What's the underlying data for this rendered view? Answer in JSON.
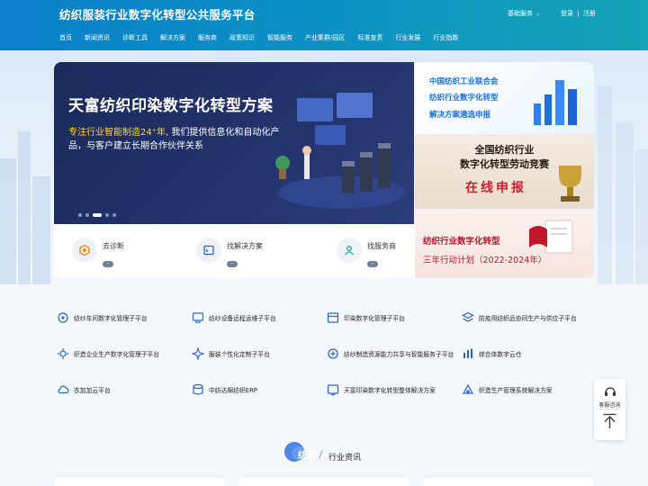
{
  "header": {
    "site_title": "纺织服装行业数字化转型公共服务平台",
    "basic_services": "基础服务",
    "login": "登录",
    "separator": "|",
    "register": "注册"
  },
  "nav": [
    "首页",
    "新闻资讯",
    "诊断工具",
    "解决方案",
    "服务商",
    "政策知识",
    "智能服务",
    "产业集群/园区",
    "标准宣贯",
    "行业发展",
    "行业指数"
  ],
  "banner": {
    "title": "天富纺织印染数字化转型方案",
    "subtitle_highlight": "专注行业智能制造24⁺年,",
    "subtitle_rest": " 我们提供信息化和自动化产品，与客户建立长期合作伙伴关系",
    "slide_count": 5,
    "active_slide": 3
  },
  "promos": {
    "p1": [
      "中国纺织工业联合会",
      "纺织行业数字化转型",
      "解决方案遴选申报"
    ],
    "p2": [
      "全国纺织行业",
      "数字化转型劳动竞赛",
      "在线申报"
    ],
    "p3": [
      "纺织行业数字化转型",
      "三年行动计划（2022-2024年）"
    ]
  },
  "quick_links": [
    {
      "label": "去诊断",
      "icon": "diagnose-icon"
    },
    {
      "label": "找解决方案",
      "icon": "solution-icon"
    },
    {
      "label": "找服务商",
      "icon": "provider-icon"
    }
  ],
  "platforms": [
    {
      "label": "纺纱车间数字化管理子平台",
      "icon": "workshop-icon"
    },
    {
      "label": "纺纱设备远程运维子平台",
      "icon": "remote-ops-icon"
    },
    {
      "label": "印染数字化管理子平台",
      "icon": "dyeing-icon"
    },
    {
      "label": "防疫用纺织品协同生产与供应子平台",
      "icon": "supply-icon"
    },
    {
      "label": "织造企业生产数字化管理子平台",
      "icon": "weaving-icon"
    },
    {
      "label": "服装个性化定制子平台",
      "icon": "custom-icon"
    },
    {
      "label": "纺纱制造资源能力共享与智能服务子平台",
      "icon": "share-icon"
    },
    {
      "label": "综合体数字云仓",
      "icon": "warehouse-icon"
    },
    {
      "label": "衣加加云平台",
      "icon": "cloud-icon"
    },
    {
      "label": "中纺达棉纺织ERP",
      "icon": "erp-icon"
    },
    {
      "label": "天富印染数字化转型整体解决方案",
      "icon": "solution-doc-icon"
    },
    {
      "label": "织造生产管理系统解决方案",
      "icon": "system-icon"
    }
  ],
  "section": {
    "badge": "纺织",
    "title": "行业资讯"
  },
  "side": {
    "consult": "客服咨询"
  },
  "colors": {
    "header_start": "#0a7fc8",
    "header_end": "#15a3b6",
    "accent": "#1a61c9",
    "banner_bg": "#23336b",
    "highlight": "#ffd34a",
    "promo_red": "#d11f2a"
  }
}
